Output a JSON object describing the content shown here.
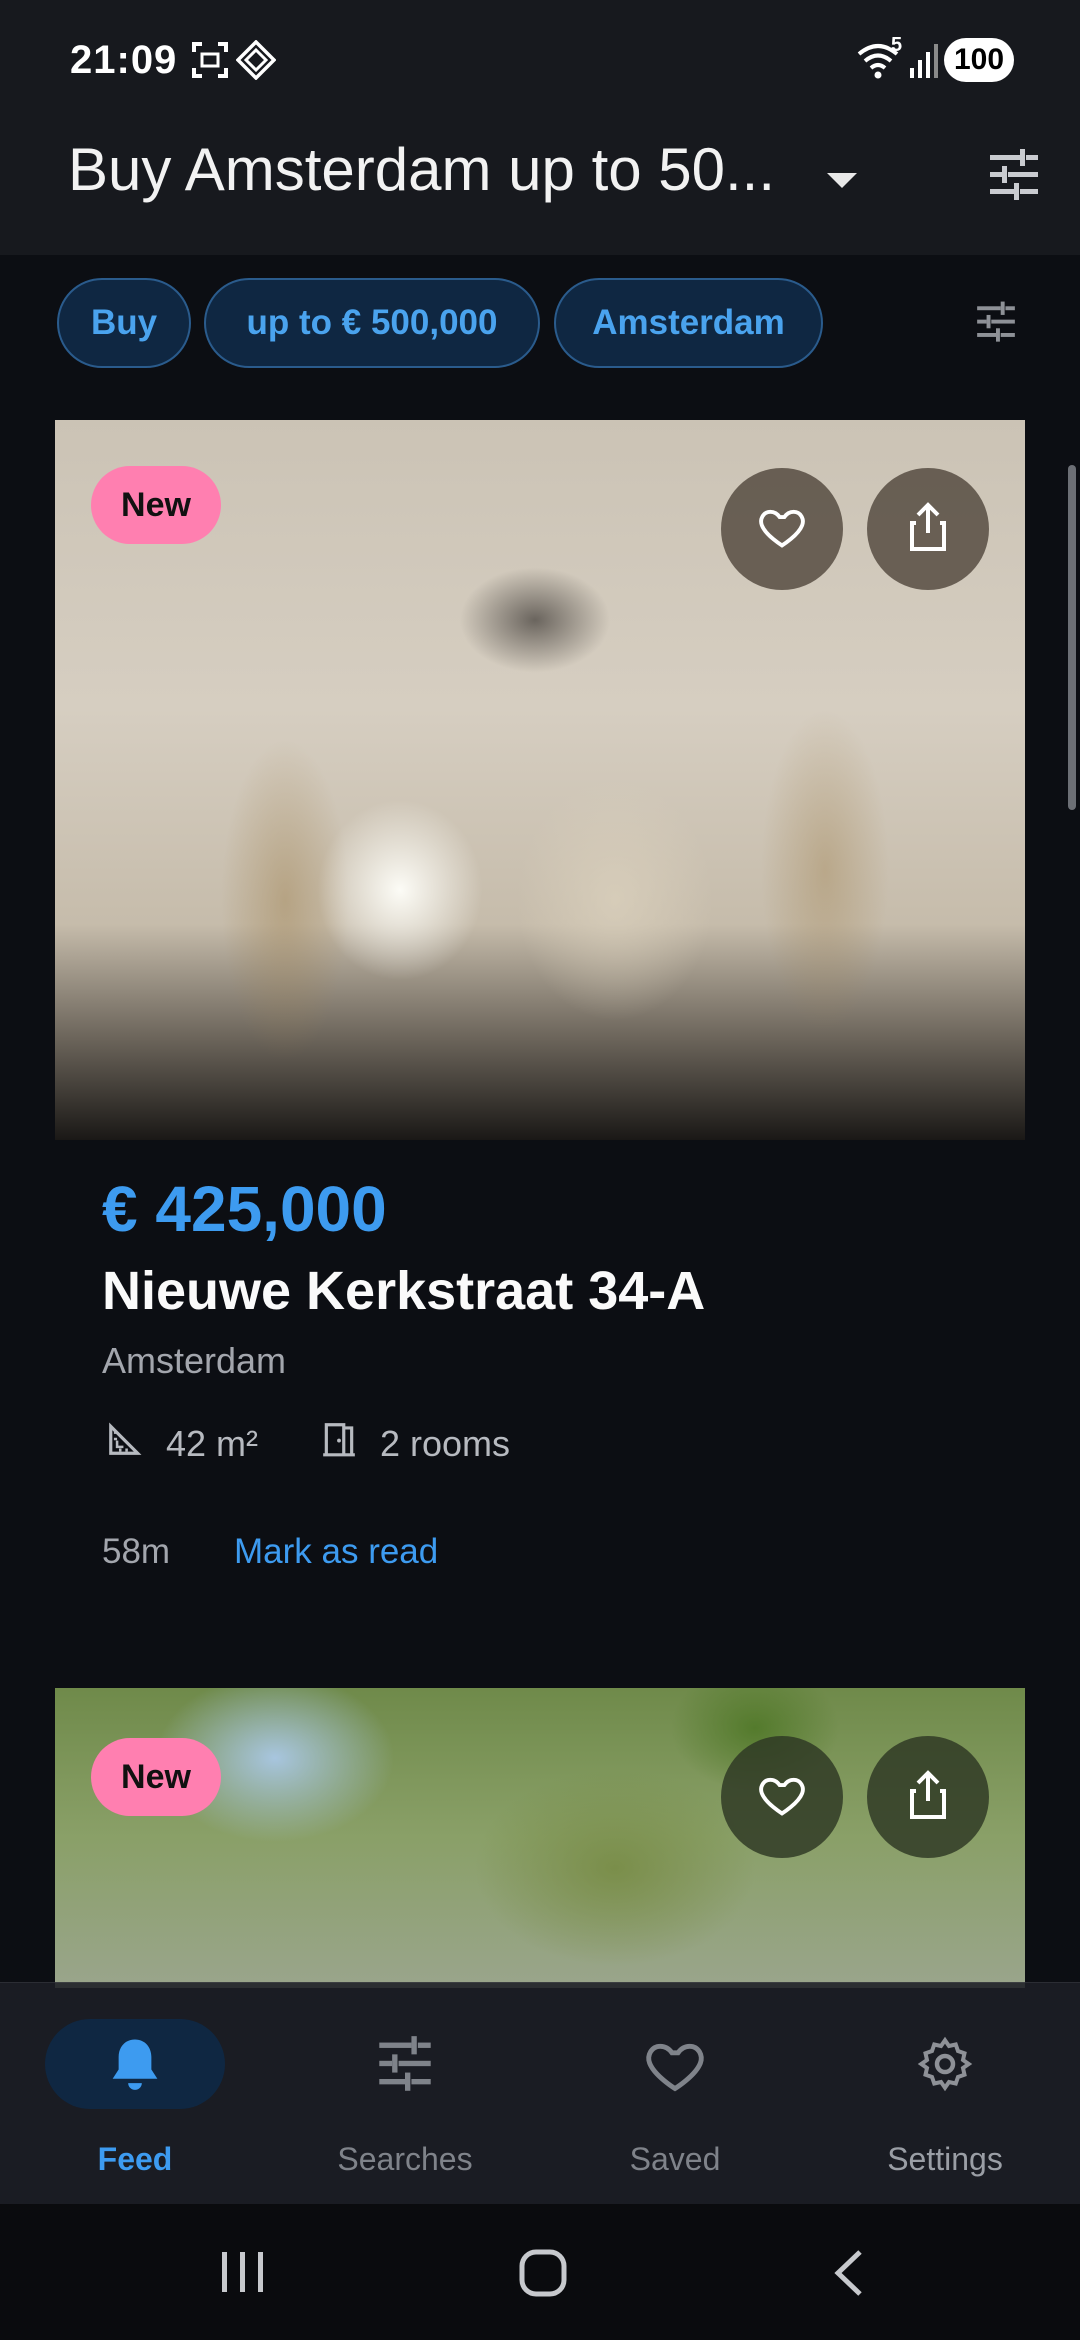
{
  "status_bar": {
    "time": "21:09",
    "battery": "100",
    "wifi_label": "5",
    "icons": [
      "screenshot-icon",
      "vpn-icon",
      "wifi-icon",
      "signal-icon",
      "battery-icon"
    ]
  },
  "app_bar": {
    "title": "Buy Amsterdam up to 50...",
    "icons": [
      "dropdown-icon",
      "tune-icon"
    ]
  },
  "filters": {
    "chips": [
      "Buy",
      "up to € 500,000",
      "Amsterdam"
    ]
  },
  "listings": [
    {
      "badge": "New",
      "price": "€ 425,000",
      "address": "Nieuwe Kerkstraat 34-A",
      "city": "Amsterdam",
      "area": "42 m²",
      "rooms": "2 rooms",
      "age": "58m",
      "action": "Mark as read"
    },
    {
      "badge": "New"
    }
  ],
  "bottom_nav": {
    "items": [
      {
        "label": "Feed",
        "icon": "bell-icon",
        "active": true
      },
      {
        "label": "Searches",
        "icon": "tune-icon",
        "active": false
      },
      {
        "label": "Saved",
        "icon": "heart-icon",
        "active": false
      },
      {
        "label": "Settings",
        "icon": "gear-icon",
        "active": false
      }
    ]
  },
  "colors": {
    "accent": "#3d9bf0",
    "badge": "#ff7fb0",
    "background": "#0c0e13",
    "chip_bg": "#0f2742"
  }
}
